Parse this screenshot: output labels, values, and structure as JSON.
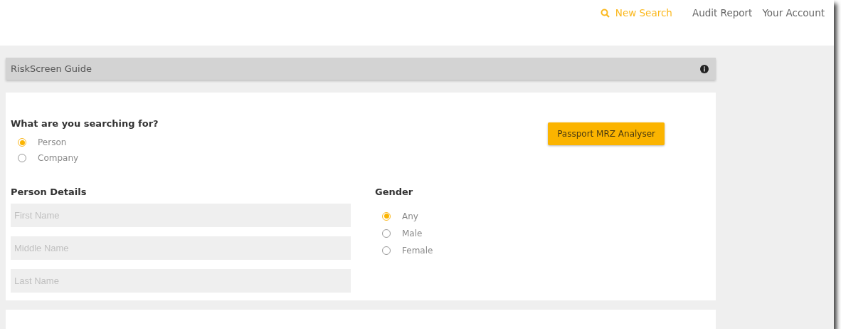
{
  "nav": [
    {
      "label": "New Search",
      "kind": "search",
      "selected": true
    },
    {
      "label": "Audit Report",
      "kind": "link",
      "selected": false
    },
    {
      "label": "Your Account",
      "kind": "link",
      "selected": false
    }
  ],
  "guide": {
    "title": "RiskScreen Guide"
  },
  "search_for": {
    "heading": "What are you searching for?",
    "options": [
      {
        "label": "Person",
        "selected": true
      },
      {
        "label": "Company",
        "selected": false
      }
    ]
  },
  "mrz_button": "Passport MRZ Analyser",
  "person_details": {
    "heading": "Person Details",
    "fields": [
      {
        "placeholder": "First Name"
      },
      {
        "placeholder": "Middle Name"
      },
      {
        "placeholder": "Last Name"
      }
    ]
  },
  "gender": {
    "heading": "Gender",
    "options": [
      {
        "label": "Any",
        "selected": true
      },
      {
        "label": "Male",
        "selected": false
      },
      {
        "label": "Female",
        "selected": false
      }
    ]
  }
}
